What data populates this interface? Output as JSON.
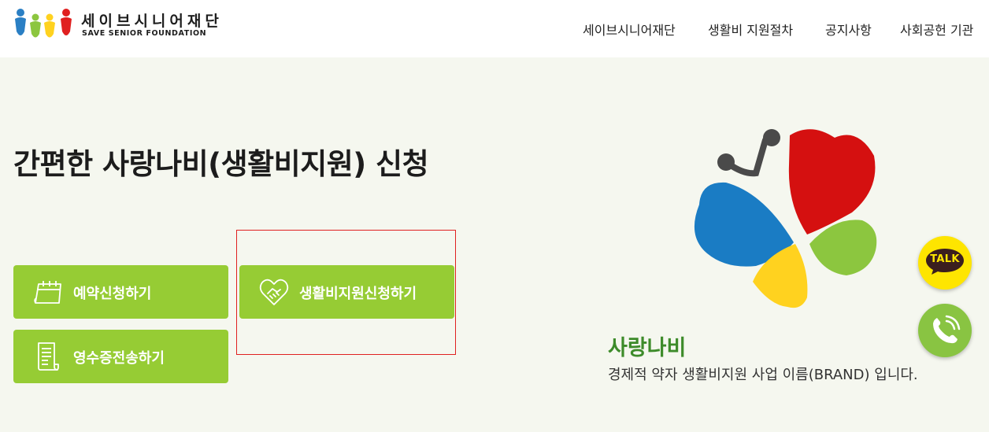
{
  "header": {
    "logo_title": "세이브시니어재단",
    "logo_subtitle": "SAVE SENIOR FOUNDATION",
    "nav": [
      "세이브시니어재단",
      "생활비 지원절차",
      "공지사항",
      "사회공헌 기관"
    ]
  },
  "main": {
    "headline": "간편한 사랑나비(생활비지원) 신청",
    "buttons": [
      {
        "label": "예약신청하기",
        "icon": "calendar-icon"
      },
      {
        "label": "생활비지원신청하기",
        "icon": "handshake-heart-icon"
      },
      {
        "label": "영수증전송하기",
        "icon": "receipt-icon"
      }
    ]
  },
  "brand": {
    "name": "사랑나비",
    "description": "경제적 약자 생활비지원 사업 이름(BRAND) 입니다."
  },
  "floating": {
    "talk_label": "TALK",
    "call_icon": "phone-icon"
  },
  "colors": {
    "accent_green": "#96cc34",
    "brand_green": "#3d8b2a",
    "kakao_yellow": "#fee500",
    "highlight_red": "#e02020"
  }
}
